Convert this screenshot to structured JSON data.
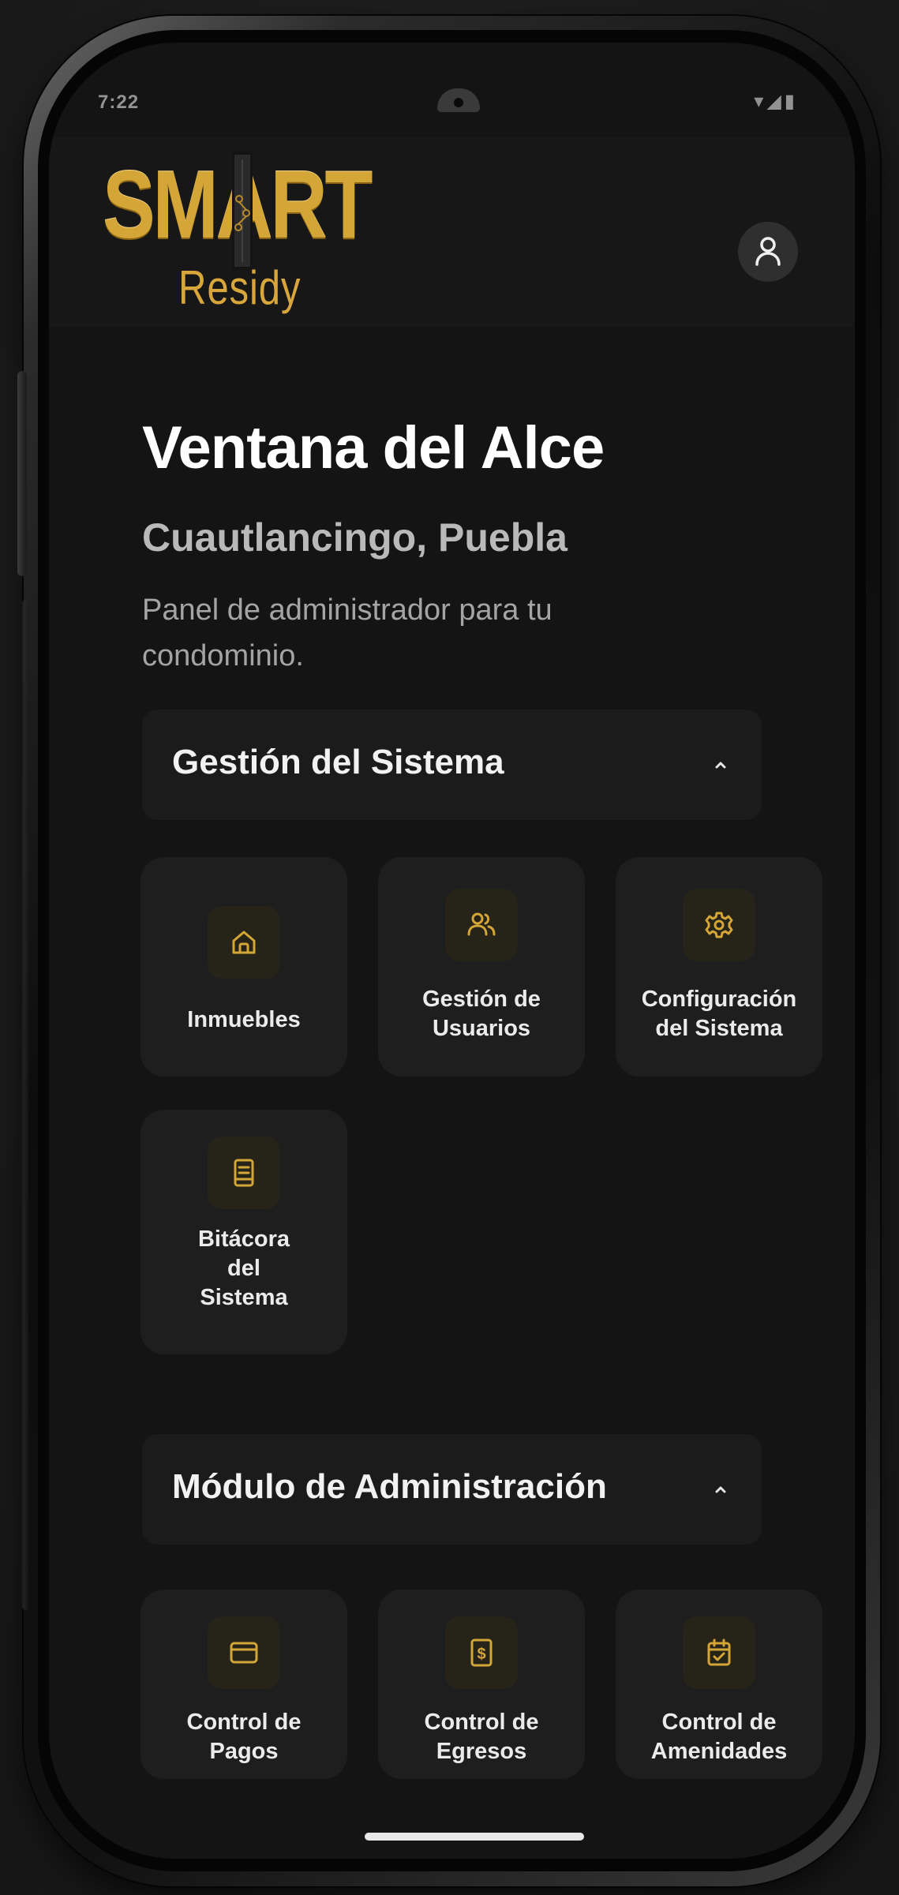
{
  "status_bar": {
    "time": "7:22",
    "indicators": "▾◢▮"
  },
  "header": {
    "logo": {
      "smart": "SMART",
      "residy": "Residy"
    },
    "profile_icon": "user-icon"
  },
  "hero": {
    "title": "Ventana del Alce",
    "subtitle": "Cuautlancingo, Puebla",
    "description": "Panel de administrador para tu condominio."
  },
  "sections": [
    {
      "title": "Gestión del Sistema",
      "expanded": true,
      "tiles": [
        {
          "label": "Inmuebles",
          "icon": "home-icon"
        },
        {
          "label": "Gestión de\nUsuarios",
          "icon": "users-icon"
        },
        {
          "label": "Configuración\ndel Sistema",
          "icon": "gear-icon"
        },
        {
          "label": "Bitácora\ndel\nSistema",
          "icon": "log-book-icon"
        }
      ]
    },
    {
      "title": "Módulo de Administración",
      "expanded": true,
      "tiles": [
        {
          "label": "Control de\nPagos",
          "icon": "credit-card-icon"
        },
        {
          "label": "Control de\nEgresos",
          "icon": "dollar-receipt-icon"
        },
        {
          "label": "Control de\nAmenidades",
          "icon": "calendar-check-icon"
        }
      ]
    }
  ],
  "colors": {
    "accent_gold": "#d4a537",
    "background": "#141414",
    "card": "#1e1e1e",
    "text_primary": "#ffffff",
    "text_secondary": "#a4a4a4"
  }
}
